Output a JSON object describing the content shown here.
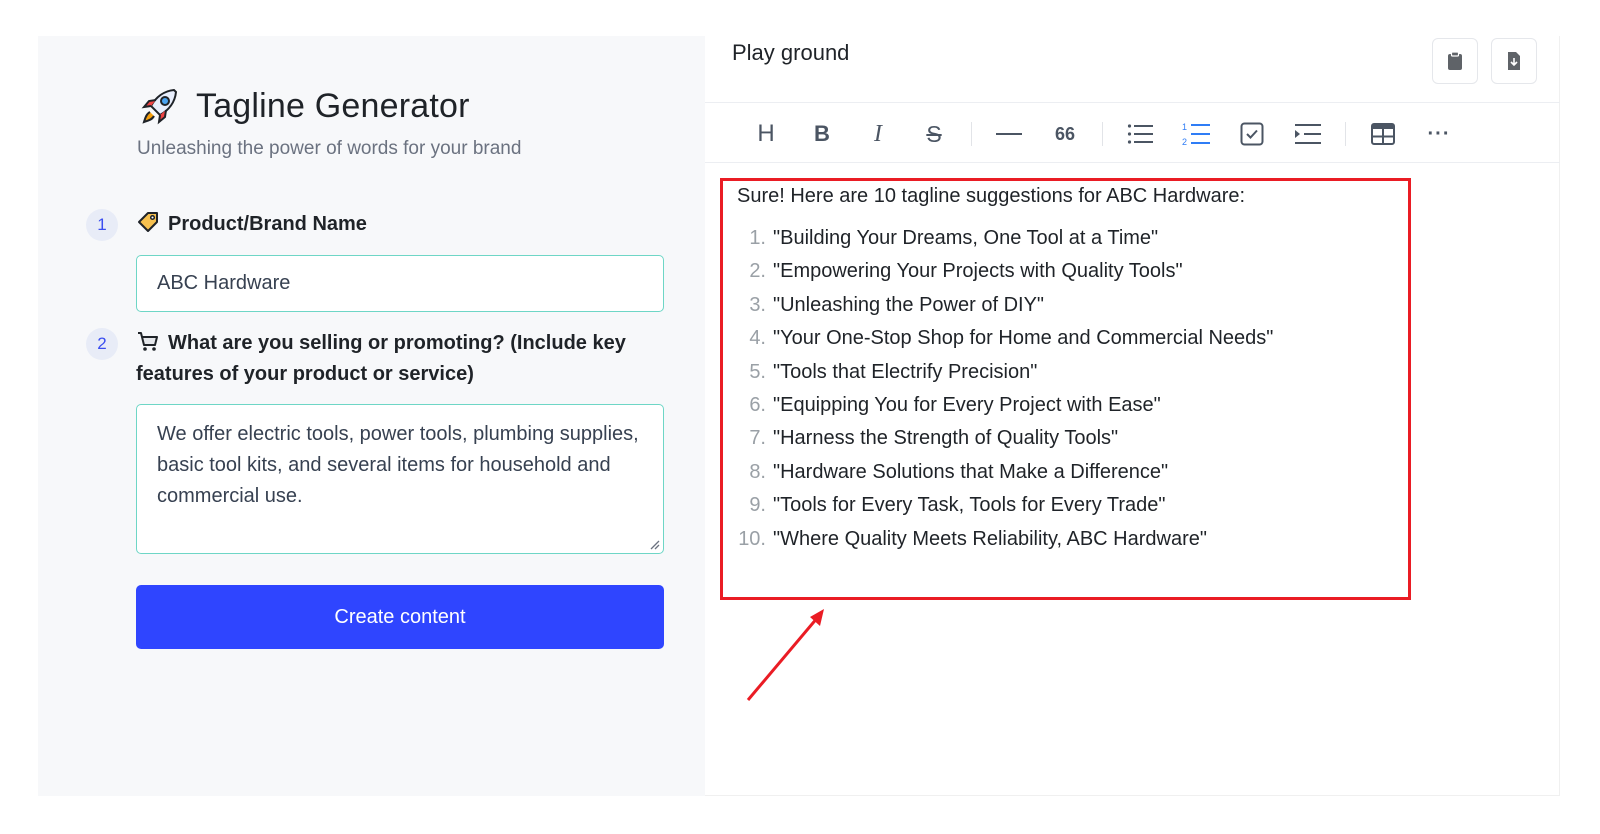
{
  "app": {
    "title": "Tagline Generator",
    "subtitle": "Unleashing the power of words for your brand",
    "icon": "rocket-icon"
  },
  "form": {
    "step1": {
      "number": "1",
      "label": "Product/Brand Name",
      "icon": "tag-icon",
      "value": "ABC Hardware"
    },
    "step2": {
      "number": "2",
      "label_line1": "What are you selling or promoting? (Include key",
      "label_line2": "features of your product or service)",
      "icon": "shopping-cart-icon",
      "value": "We offer electric tools, power tools, plumbing supplies, basic tool kits, and several items for household and commercial use."
    },
    "submit_label": "Create content"
  },
  "playground": {
    "title": "Play ground",
    "actions": [
      "clipboard-icon",
      "download-icon"
    ],
    "toolbar": [
      "heading-icon",
      "bold-icon",
      "italic-icon",
      "strikethrough-icon",
      "horizontal-rule-icon",
      "quote-icon",
      "bullet-list-icon",
      "ordered-list-icon",
      "checklist-icon",
      "indent-icon",
      "table-icon",
      "more-icon"
    ],
    "toolbar_heading_glyph": "H",
    "toolbar_bold_glyph": "B",
    "toolbar_italic_glyph": "I",
    "toolbar_strike_glyph": "S",
    "toolbar_quote_glyph": "66",
    "toolbar_more_glyph": "···"
  },
  "output": {
    "intro": "Sure! Here are 10 tagline suggestions for ABC Hardware:",
    "items": [
      {
        "n": "1.",
        "text": "\"Building Your Dreams, One Tool at a Time\""
      },
      {
        "n": "2.",
        "text": "\"Empowering Your Projects with Quality Tools\""
      },
      {
        "n": "3.",
        "text": "\"Unleashing the Power of DIY\""
      },
      {
        "n": "4.",
        "text": "\"Your One-Stop Shop for Home and Commercial Needs\""
      },
      {
        "n": "5.",
        "text": "\"Tools that Electrify Precision\""
      },
      {
        "n": "6.",
        "text": "\"Equipping You for Every Project with Ease\""
      },
      {
        "n": "7.",
        "text": "\"Harness the Strength of Quality Tools\""
      },
      {
        "n": "8.",
        "text": "\"Hardware Solutions that Make a Difference\""
      },
      {
        "n": "9.",
        "text": "\"Tools for Every Task, Tools for Every Trade\""
      },
      {
        "n": "10.",
        "text": "\"Where Quality Meets Reliability, ABC Hardware\""
      }
    ]
  },
  "colors": {
    "accent": "#2f45ff",
    "input_border": "#6ed6c6",
    "highlight": "#ea1c24",
    "active_tool": "#2f7df6"
  }
}
